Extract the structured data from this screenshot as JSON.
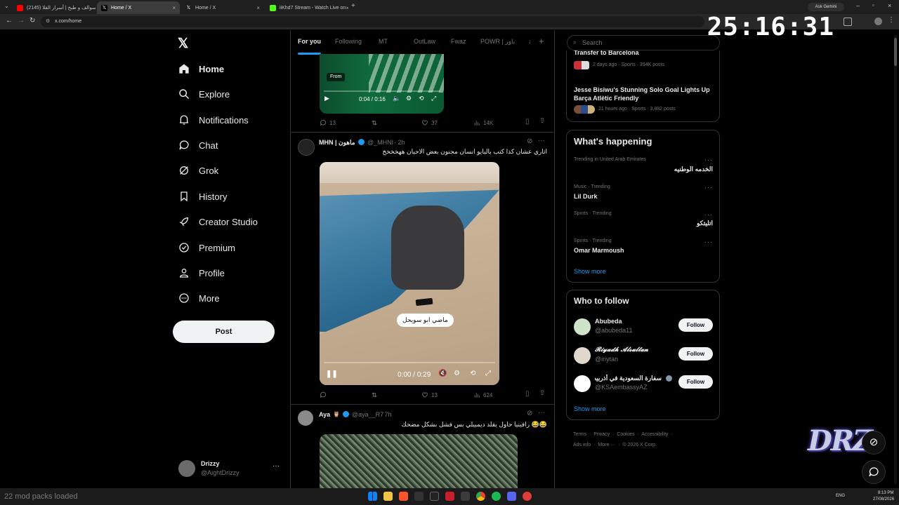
{
  "browser": {
    "tabs": [
      {
        "label": "(2145) سوالف و طبخ | أسرار الفلا",
        "active": false,
        "icon_color": "#ff0000"
      },
      {
        "label": "Home / X",
        "active": true,
        "icon_color": "#ffffff"
      },
      {
        "label": "Home / X",
        "active": false,
        "icon_color": "#ffffff"
      },
      {
        "label": "iiKhd7 Stream - Watch Live on",
        "active": false,
        "icon_color": "#53fc18"
      }
    ],
    "url": "x.com/home",
    "ask_gemini": "Ask Gemini"
  },
  "overlay": {
    "clock": "25:16:31",
    "mod_status": "22 mod packs loaded",
    "logo_text": "DRZ"
  },
  "nav": {
    "items": [
      {
        "label": "Home",
        "icon": "home-icon"
      },
      {
        "label": "Explore",
        "icon": "search-icon"
      },
      {
        "label": "Notifications",
        "icon": "bell-icon"
      },
      {
        "label": "Chat",
        "icon": "chat-icon"
      },
      {
        "label": "Grok",
        "icon": "grok-icon"
      },
      {
        "label": "History",
        "icon": "bookmark-icon"
      },
      {
        "label": "Creator Studio",
        "icon": "rocket-icon"
      },
      {
        "label": "Premium",
        "icon": "verified-icon"
      },
      {
        "label": "Profile",
        "icon": "person-icon"
      },
      {
        "label": "More",
        "icon": "more-circle-icon"
      }
    ],
    "post_label": "Post",
    "account": {
      "name": "Drizzy",
      "handle": "@AightDrizzy"
    }
  },
  "feed": {
    "tabs": [
      "For you",
      "Following",
      "MT",
      "OutLaw",
      "Fwaz",
      "POWR | باور",
      "↓"
    ],
    "first_video": {
      "from_label": "From",
      "time": "0:04 / 0:16",
      "replies": "13",
      "likes": "37",
      "views": "14K"
    },
    "tweet1": {
      "name": "MHN | ماهون",
      "handle": "@_MHNI",
      "time": "· 2h",
      "text": "اثاري عشان كذا كتب بالبايو انسان مجنون بعض الاحيان ههخخخخ",
      "video_caption": "ماضي ابو سويحل",
      "video_time": "0:00 / 0:29",
      "likes": "13",
      "views": "624"
    },
    "tweet2": {
      "name": "Aya",
      "handle": "@aya__R7",
      "time": "· 7h",
      "text": "😂😂 رافينيا حاول يقلد ديمبيلي بس فشل بشكل مضحك"
    }
  },
  "sidebar": {
    "search_placeholder": "Search",
    "trend_top": {
      "title": "Transfer to Barcelona",
      "meta": "2 days ago · Sports · 394K posts"
    },
    "trend_second": {
      "title": "Jesse Bisiwu's Stunning Solo Goal Lights Up Barça Atlètic Friendly",
      "meta": "21 hours ago · Sports · 3,882 posts"
    },
    "whats_happening": {
      "heading": "What's happening",
      "items": [
        {
          "context": "Trending in United Arab Emirates",
          "title": "الخدمه الوطنيه"
        },
        {
          "context": "Music · Trending",
          "title": "Lil Durk"
        },
        {
          "context": "Sports · Trending",
          "title": "اتليتكو"
        },
        {
          "context": "Sports · Trending",
          "title": "Omar Marmoush"
        }
      ],
      "show_more": "Show more"
    },
    "who_to_follow": {
      "heading": "Who to follow",
      "accounts": [
        {
          "name": "Abubeda",
          "handle": "@abubeda11",
          "button": "Follow"
        },
        {
          "name": "𝓡𝓲𝔂𝓪𝓭𝓱 𝓐𝓵𝓼𝓾𝓵𝓽𝓪𝓷",
          "handle": "@iriytan",
          "button": "Follow"
        },
        {
          "name": "سفارة السعودية في أذربيجان",
          "handle": "@KSAembassyAZ",
          "button": "Follow"
        }
      ],
      "show_more": "Show more"
    },
    "footer": {
      "line1": [
        "Terms",
        "Privacy",
        "Cookies",
        "Accessibility"
      ],
      "line2": [
        "Ads info",
        "More ···",
        "© 2026 X Corp."
      ]
    }
  },
  "taskbar": {
    "lang": "ENG",
    "time": "8:13 PM",
    "date": "27/08/2026"
  },
  "colors": {
    "accent": "#1d9bf0",
    "background": "#000000",
    "border": "#2f3336",
    "muted": "#71767b"
  }
}
